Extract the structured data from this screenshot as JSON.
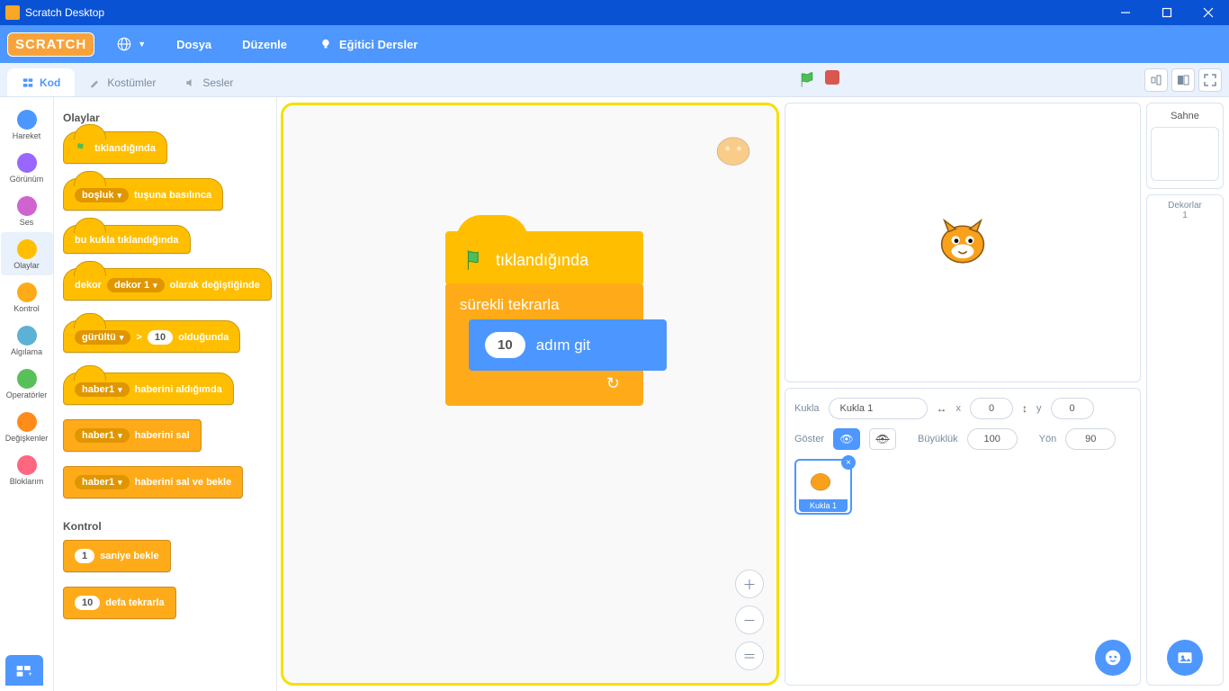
{
  "window": {
    "title": "Scratch Desktop"
  },
  "menu": {
    "file": "Dosya",
    "edit": "Düzenle",
    "tutorials": "Eğitici Dersler",
    "logo": "SCRATCH"
  },
  "tabs": {
    "code": "Kod",
    "costumes": "Kostümler",
    "sounds": "Sesler"
  },
  "categories": [
    {
      "name": "Hareket",
      "color": "#4c97ff"
    },
    {
      "name": "Görünüm",
      "color": "#9966ff"
    },
    {
      "name": "Ses",
      "color": "#cf63cf"
    },
    {
      "name": "Olaylar",
      "color": "#ffbf00",
      "selected": true
    },
    {
      "name": "Kontrol",
      "color": "#ffab19"
    },
    {
      "name": "Algılama",
      "color": "#5cb1d6"
    },
    {
      "name": "Operatörler",
      "color": "#59c059"
    },
    {
      "name": "Değişkenler",
      "color": "#ff8c1a"
    },
    {
      "name": "Bloklarım",
      "color": "#ff6680"
    }
  ],
  "palette": {
    "events_header": "Olaylar",
    "when_flag": "tıklandığında",
    "when_key": {
      "dd": "boşluk",
      "suffix": "tuşuna basılınca"
    },
    "when_sprite_clicked": "bu kukla tıklandığında",
    "when_backdrop": {
      "prefix": "dekor",
      "dd": "dekor 1",
      "suffix": "olarak değiştiğinde"
    },
    "when_gt": {
      "dd": "gürültü",
      "op": ">",
      "val": "10",
      "suffix": "olduğunda"
    },
    "when_receive": {
      "dd": "haber1",
      "suffix": "haberini aldığımda"
    },
    "broadcast": {
      "dd": "haber1",
      "suffix": "haberini sal"
    },
    "broadcast_wait": {
      "dd": "haber1",
      "suffix": "haberini sal ve bekle"
    },
    "control_header": "Kontrol",
    "wait": {
      "val": "1",
      "suffix": "saniye bekle"
    },
    "repeat": {
      "val": "10",
      "suffix": "defa tekrarla"
    }
  },
  "script": {
    "hat": "tıklandığında",
    "forever": "sürekli tekrarla",
    "move_val": "10",
    "move_suffix": "adım git"
  },
  "sprite_info": {
    "label_sprite": "Kukla",
    "name": "Kukla 1",
    "x_label": "x",
    "x": "0",
    "y_label": "y",
    "y": "0",
    "show_label": "Göster",
    "size_label": "Büyüklük",
    "size": "100",
    "dir_label": "Yön",
    "dir": "90",
    "thumb_name": "Kukla 1"
  },
  "stage": {
    "header": "Sahne",
    "backdrops": "Dekorlar",
    "count": "1"
  }
}
